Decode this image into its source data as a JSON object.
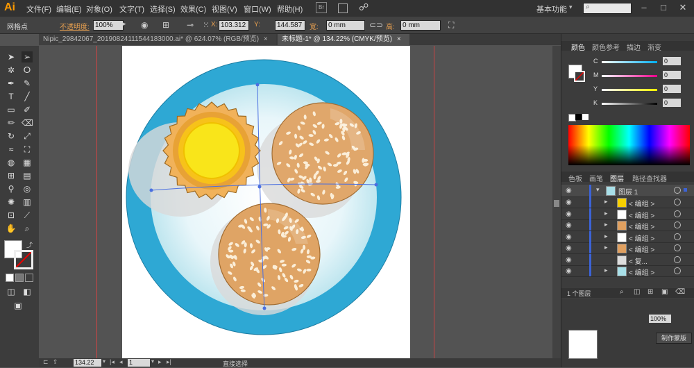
{
  "app": {
    "logo": "Ai",
    "workspace": "基本功能"
  },
  "menu": [
    "文件(F)",
    "编辑(E)",
    "对象(O)",
    "文字(T)",
    "选择(S)",
    "效果(C)",
    "视图(V)",
    "窗口(W)",
    "帮助(H)"
  ],
  "control": {
    "selection_label": "网格点",
    "opacity_label": "不透明度:",
    "opacity_value": "100%",
    "x_label": "X:",
    "x_value": "103.312",
    "y_label": "Y:",
    "y_value": "144.587",
    "w_label": "宽:",
    "w_value": "0 mm",
    "h_label": "高:",
    "h_value": "0 mm"
  },
  "tabs": [
    {
      "label": "Nipic_29842067_20190824111544183000.ai* @ 624.07% (RGB/预览)",
      "close": "×"
    },
    {
      "label": "未标题-1* @ 134.22% (CMYK/预览)",
      "close": "×"
    }
  ],
  "color_panel": {
    "tabs": [
      "颜色",
      "颜色参考",
      "描边",
      "渐变"
    ],
    "channels": [
      {
        "name": "C",
        "value": "0",
        "color": "#00aeef"
      },
      {
        "name": "M",
        "value": "0",
        "color": "#ec008c"
      },
      {
        "name": "Y",
        "value": "0",
        "color": "#fff200"
      },
      {
        "name": "K",
        "value": "0",
        "color": "#000000"
      }
    ]
  },
  "layers_panel": {
    "tabs": [
      "色板",
      "画笔",
      "图层",
      "路径查找器"
    ],
    "layer_name": "图层 1",
    "rows": [
      {
        "label": "< 编组 >",
        "thumb": "#f7d000"
      },
      {
        "label": "< 编组 >",
        "thumb": "#ffffff"
      },
      {
        "label": "< 编组 >",
        "thumb": "#e0a060"
      },
      {
        "label": "< 编组 >",
        "thumb": "#ffffff"
      },
      {
        "label": "< 编组 >",
        "thumb": "#e0a060"
      },
      {
        "label": "< 复...",
        "thumb": "#dddddd"
      },
      {
        "label": "< 编组 >",
        "thumb": "#a8dfe8"
      }
    ],
    "footer": "1 个图层"
  },
  "transparency": {
    "value": "100%",
    "button": "制作蒙版"
  },
  "status": {
    "zoom": "134.22",
    "page": "1",
    "tool": "直接选择"
  },
  "artwork_colors": {
    "rim": "#2ea8d4",
    "plate_inner": "#dff3f8",
    "cookie": "#dfa465",
    "seed": "#fbeed8",
    "tart_crust": "#f0a830",
    "tart_yellow": "#f9e51a"
  }
}
